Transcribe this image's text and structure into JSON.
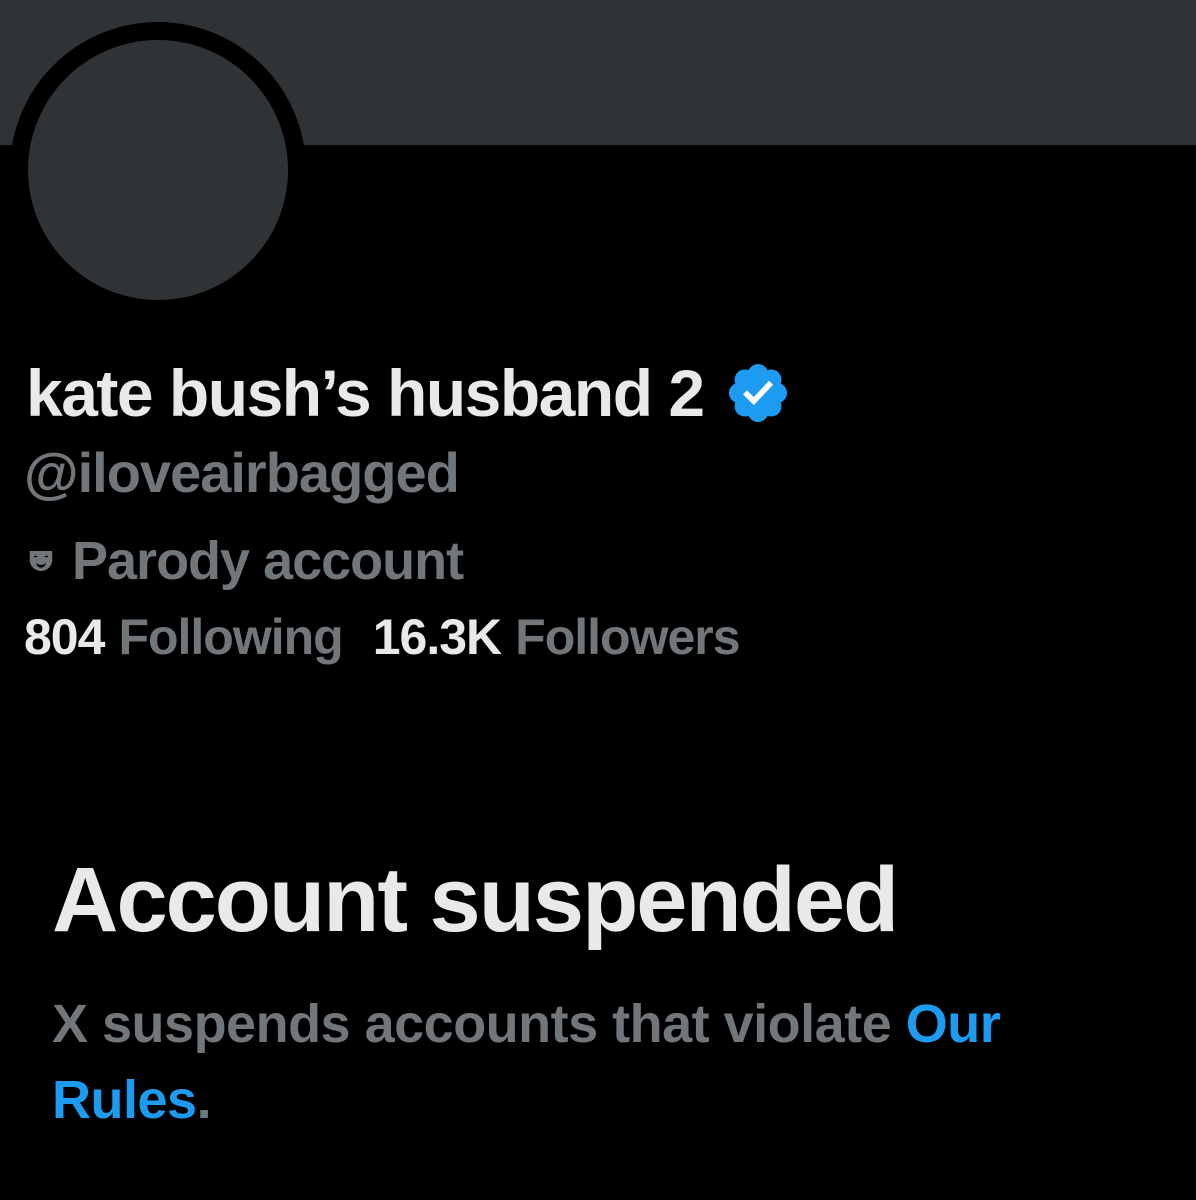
{
  "profile": {
    "display_name": "kate bush’s husband 2",
    "handle": "@iloveairbagged",
    "parody_label": "Parody account",
    "verified_icon": "verified-badge-icon",
    "parody_icon": "theater-mask-icon",
    "verified_color": "#1d9bf0"
  },
  "stats": {
    "following_count": "804",
    "following_label": "Following",
    "followers_count": "16.3K",
    "followers_label": "Followers"
  },
  "suspension": {
    "title": "Account suspended",
    "description_text": "X suspends accounts that violate ",
    "rules_link": "Our Rules",
    "period": "."
  },
  "colors": {
    "background": "#000000",
    "banner": "#2f3336",
    "primary_text": "#e7e9ea",
    "secondary_text": "#71767b",
    "link": "#1d9bf0"
  }
}
